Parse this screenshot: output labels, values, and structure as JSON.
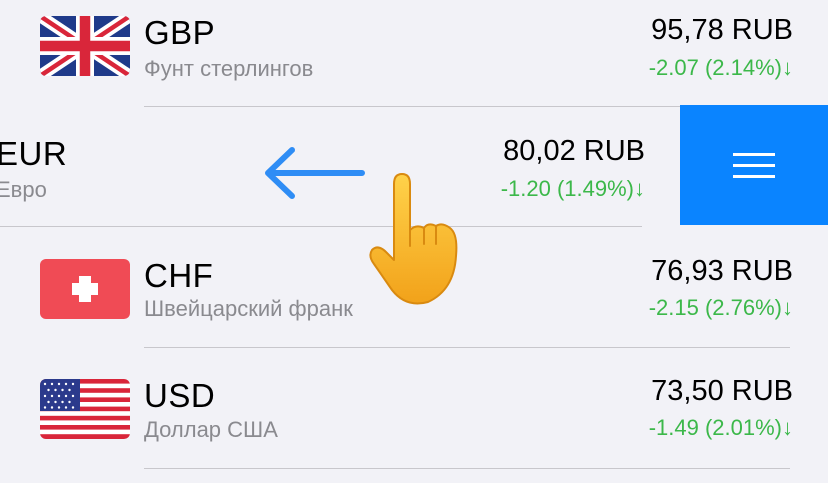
{
  "rows": [
    {
      "code": "GBP",
      "name": "Фунт стерлингов",
      "rate": "95,78 RUB",
      "change": "-2.07 (2.14%)↓",
      "flag_icon": "uk-flag-icon"
    },
    {
      "code": "EUR",
      "name": "Евро",
      "rate": "80,02 RUB",
      "change": "-1.20 (1.49%)↓",
      "flag_icon": "eu-flag-icon"
    },
    {
      "code": "CHF",
      "name": "Швейцарский франк",
      "rate": "76,93 RUB",
      "change": "-2.15 (2.76%)↓",
      "flag_icon": "swiss-flag-icon"
    },
    {
      "code": "USD",
      "name": "Доллар США",
      "rate": "73,50 RUB",
      "change": "-1.49 (2.01%)↓",
      "flag_icon": "us-flag-icon"
    }
  ],
  "swipe_action": {
    "icon": "hamburger-menu-icon",
    "color": "#0a84ff"
  },
  "gesture_hint": {
    "arrow": "swipe-left-arrow-icon",
    "hand": "pointing-hand-icon",
    "arrow_color": "#2f8df5"
  },
  "colors": {
    "background": "#f2f2f7",
    "change_down": "#3cb84a",
    "separator": "#c8c7cc"
  }
}
